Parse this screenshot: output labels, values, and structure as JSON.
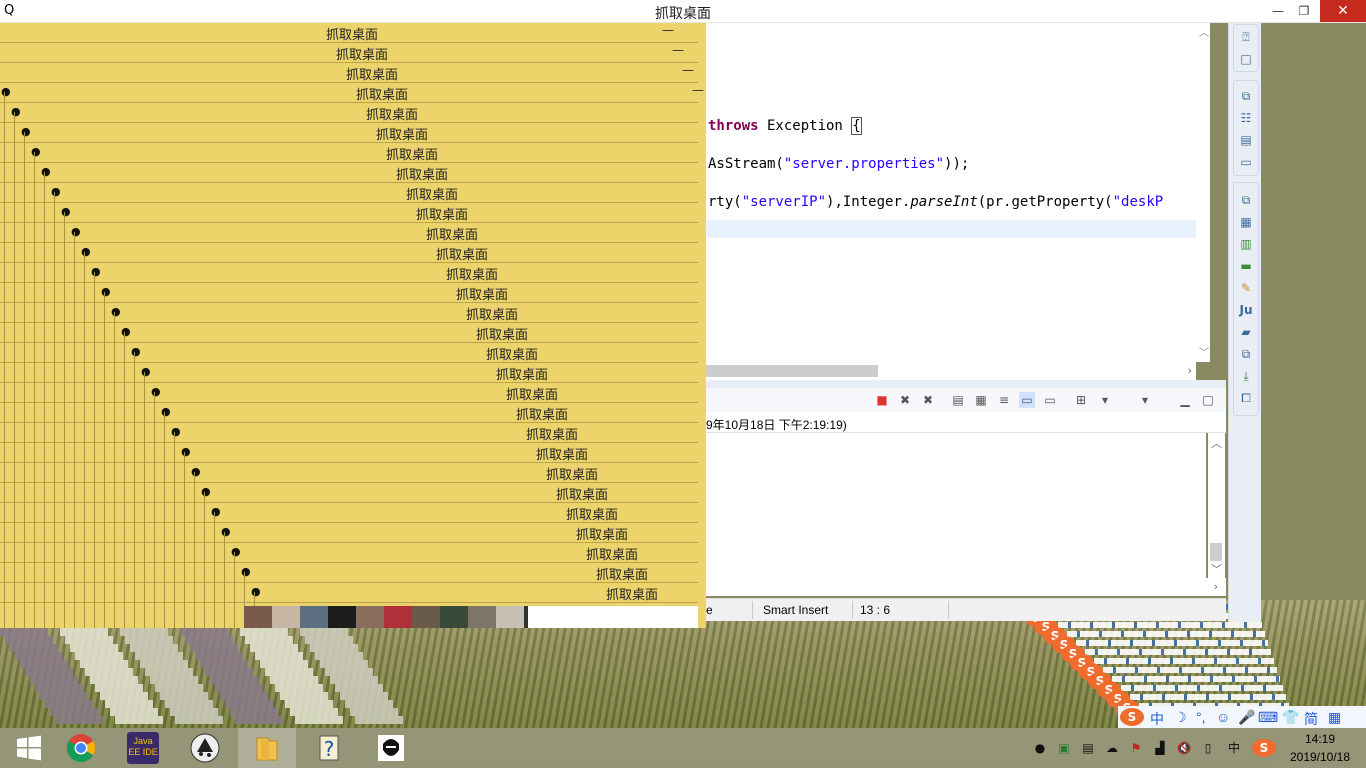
{
  "window": {
    "title": "抓取桌面",
    "minimize_glyph": "—",
    "maximize_glyph": "❐",
    "close_glyph": "✕",
    "app_icon": "penguin-icon"
  },
  "editor": {
    "line1": {
      "kw": "throws",
      "rest": " Exception "
    },
    "line2": {
      "a": "AsStream(",
      "s": "\"server.properties\"",
      "b": "));"
    },
    "line3": {
      "a": "rty(",
      "s1": "\"serverIP\"",
      "b": "),Integer.",
      "m": "parseInt",
      "c": "(pr.getProperty(",
      "s2": "\"deskP"
    }
  },
  "console": {
    "header": "9年10月18日 下午2:19:19)",
    "toolbar_icons": [
      "terminate-icon",
      "remove-launch-icon",
      "remove-all-icon",
      "copy-icon",
      "scroll-lock-icon",
      "word-wrap-icon",
      "show-on-stdout-icon",
      "show-on-stderr-icon",
      "pin-console-icon",
      "display-console-icon",
      "open-console-icon",
      "minimize-icon",
      "maximize-icon"
    ]
  },
  "statusbar": {
    "insert_mode": "Smart Insert",
    "position": "13 : 6",
    "left_fragment": "e"
  },
  "capture": {
    "row_title": "抓取桌面",
    "row_icon": "penguin-icon",
    "minimize_glyph": "—"
  },
  "taskbar": {
    "apps": [
      {
        "name": "start-button",
        "icon": "windows-logo-icon"
      },
      {
        "name": "chrome-button",
        "icon": "chrome-icon"
      },
      {
        "name": "javaee-ide-button",
        "icon": "java-ee-ide-icon",
        "label": "Java EE IDE"
      },
      {
        "name": "inkscape-button",
        "icon": "inkscape-icon"
      },
      {
        "name": "file-explorer-button",
        "icon": "folder-icon"
      },
      {
        "name": "help-button",
        "icon": "help-icon"
      },
      {
        "name": "che-button",
        "icon": "portrait-icon"
      }
    ],
    "clock": {
      "time": "14:19",
      "date": "2019/10/18"
    },
    "ime_lang": "中"
  },
  "ime_bar": {
    "items": [
      "中",
      "☽",
      "°,",
      "☺",
      "🎤",
      "⌨",
      "👕",
      "简",
      "▦"
    ]
  },
  "colors": {
    "capture_bg": "#ecd46a",
    "keyword": "#7f0055",
    "string": "#2a00ff"
  }
}
